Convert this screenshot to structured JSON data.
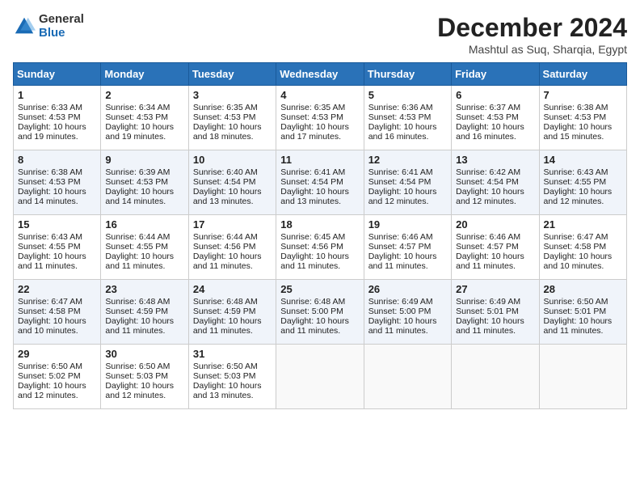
{
  "logo": {
    "general": "General",
    "blue": "Blue"
  },
  "title": "December 2024",
  "subtitle": "Mashtul as Suq, Sharqia, Egypt",
  "days_header": [
    "Sunday",
    "Monday",
    "Tuesday",
    "Wednesday",
    "Thursday",
    "Friday",
    "Saturday"
  ],
  "weeks": [
    [
      {
        "day": "1",
        "sunrise": "6:33 AM",
        "sunset": "4:53 PM",
        "daylight": "10 hours and 19 minutes."
      },
      {
        "day": "2",
        "sunrise": "6:34 AM",
        "sunset": "4:53 PM",
        "daylight": "10 hours and 19 minutes."
      },
      {
        "day": "3",
        "sunrise": "6:35 AM",
        "sunset": "4:53 PM",
        "daylight": "10 hours and 18 minutes."
      },
      {
        "day": "4",
        "sunrise": "6:35 AM",
        "sunset": "4:53 PM",
        "daylight": "10 hours and 17 minutes."
      },
      {
        "day": "5",
        "sunrise": "6:36 AM",
        "sunset": "4:53 PM",
        "daylight": "10 hours and 16 minutes."
      },
      {
        "day": "6",
        "sunrise": "6:37 AM",
        "sunset": "4:53 PM",
        "daylight": "10 hours and 16 minutes."
      },
      {
        "day": "7",
        "sunrise": "6:38 AM",
        "sunset": "4:53 PM",
        "daylight": "10 hours and 15 minutes."
      }
    ],
    [
      {
        "day": "8",
        "sunrise": "6:38 AM",
        "sunset": "4:53 PM",
        "daylight": "10 hours and 14 minutes."
      },
      {
        "day": "9",
        "sunrise": "6:39 AM",
        "sunset": "4:53 PM",
        "daylight": "10 hours and 14 minutes."
      },
      {
        "day": "10",
        "sunrise": "6:40 AM",
        "sunset": "4:54 PM",
        "daylight": "10 hours and 13 minutes."
      },
      {
        "day": "11",
        "sunrise": "6:41 AM",
        "sunset": "4:54 PM",
        "daylight": "10 hours and 13 minutes."
      },
      {
        "day": "12",
        "sunrise": "6:41 AM",
        "sunset": "4:54 PM",
        "daylight": "10 hours and 12 minutes."
      },
      {
        "day": "13",
        "sunrise": "6:42 AM",
        "sunset": "4:54 PM",
        "daylight": "10 hours and 12 minutes."
      },
      {
        "day": "14",
        "sunrise": "6:43 AM",
        "sunset": "4:55 PM",
        "daylight": "10 hours and 12 minutes."
      }
    ],
    [
      {
        "day": "15",
        "sunrise": "6:43 AM",
        "sunset": "4:55 PM",
        "daylight": "10 hours and 11 minutes."
      },
      {
        "day": "16",
        "sunrise": "6:44 AM",
        "sunset": "4:55 PM",
        "daylight": "10 hours and 11 minutes."
      },
      {
        "day": "17",
        "sunrise": "6:44 AM",
        "sunset": "4:56 PM",
        "daylight": "10 hours and 11 minutes."
      },
      {
        "day": "18",
        "sunrise": "6:45 AM",
        "sunset": "4:56 PM",
        "daylight": "10 hours and 11 minutes."
      },
      {
        "day": "19",
        "sunrise": "6:46 AM",
        "sunset": "4:57 PM",
        "daylight": "10 hours and 11 minutes."
      },
      {
        "day": "20",
        "sunrise": "6:46 AM",
        "sunset": "4:57 PM",
        "daylight": "10 hours and 11 minutes."
      },
      {
        "day": "21",
        "sunrise": "6:47 AM",
        "sunset": "4:58 PM",
        "daylight": "10 hours and 10 minutes."
      }
    ],
    [
      {
        "day": "22",
        "sunrise": "6:47 AM",
        "sunset": "4:58 PM",
        "daylight": "10 hours and 10 minutes."
      },
      {
        "day": "23",
        "sunrise": "6:48 AM",
        "sunset": "4:59 PM",
        "daylight": "10 hours and 11 minutes."
      },
      {
        "day": "24",
        "sunrise": "6:48 AM",
        "sunset": "4:59 PM",
        "daylight": "10 hours and 11 minutes."
      },
      {
        "day": "25",
        "sunrise": "6:48 AM",
        "sunset": "5:00 PM",
        "daylight": "10 hours and 11 minutes."
      },
      {
        "day": "26",
        "sunrise": "6:49 AM",
        "sunset": "5:00 PM",
        "daylight": "10 hours and 11 minutes."
      },
      {
        "day": "27",
        "sunrise": "6:49 AM",
        "sunset": "5:01 PM",
        "daylight": "10 hours and 11 minutes."
      },
      {
        "day": "28",
        "sunrise": "6:50 AM",
        "sunset": "5:01 PM",
        "daylight": "10 hours and 11 minutes."
      }
    ],
    [
      {
        "day": "29",
        "sunrise": "6:50 AM",
        "sunset": "5:02 PM",
        "daylight": "10 hours and 12 minutes."
      },
      {
        "day": "30",
        "sunrise": "6:50 AM",
        "sunset": "5:03 PM",
        "daylight": "10 hours and 12 minutes."
      },
      {
        "day": "31",
        "sunrise": "6:50 AM",
        "sunset": "5:03 PM",
        "daylight": "10 hours and 13 minutes."
      },
      null,
      null,
      null,
      null
    ]
  ]
}
